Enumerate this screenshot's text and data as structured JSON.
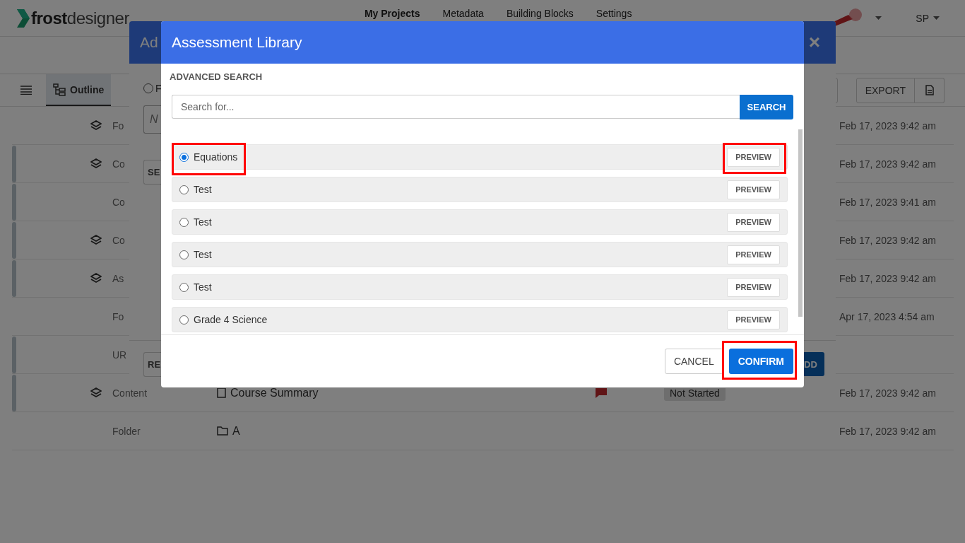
{
  "header": {
    "logo": {
      "bold": "frost",
      "light": "designer"
    },
    "nav": [
      {
        "label": "My Projects",
        "selected": true
      },
      {
        "label": "Metadata",
        "selected": false
      },
      {
        "label": "Building Blocks",
        "selected": false
      },
      {
        "label": "Settings",
        "selected": false
      }
    ],
    "user": "SP"
  },
  "toolbar": {
    "tab": {
      "label": "Outline",
      "selected": true
    },
    "export": "EXPORT"
  },
  "rows": [
    {
      "type": "Fo",
      "marked": false,
      "layers": true,
      "date": "Feb 17, 2023 9:42 am"
    },
    {
      "type": "Co",
      "marked": true,
      "layers": true,
      "date": "Feb 17, 2023 9:42 am"
    },
    {
      "type": "Co",
      "marked": true,
      "layers": false,
      "date": "Feb 17, 2023 9:41 am"
    },
    {
      "type": "Co",
      "marked": true,
      "layers": true,
      "date": "Feb 17, 2023 9:42 am"
    },
    {
      "type": "As",
      "marked": true,
      "layers": true,
      "date": "Feb 17, 2023 9:42 am"
    },
    {
      "type": "Fo",
      "marked": false,
      "layers": false,
      "date": "Apr 17, 2023 4:54 am"
    },
    {
      "type": "UR",
      "marked": true,
      "layers": false
    },
    {
      "type": "Content",
      "marked": true,
      "layers": true,
      "name": {
        "text": "Course Summary",
        "kind": "doc"
      },
      "comment": true,
      "status": "Not Started",
      "date": "Feb 17, 2023 9:42 am"
    },
    {
      "type": "Folder",
      "marked": false,
      "layers": false,
      "name": {
        "text": "A",
        "kind": "folder"
      },
      "date": "Feb 17, 2023 9:42 am"
    }
  ],
  "back_dialog": {
    "title": "Ad",
    "close": "×",
    "radio_checked": false,
    "radio_label": "F",
    "field_placeholder": "N",
    "search_button": "SE",
    "reset_button": "RE",
    "add_button": "DD"
  },
  "dialog": {
    "title": "Assessment Library",
    "section": "ADVANCED SEARCH",
    "search": {
      "placeholder": "Search for...",
      "button": "SEARCH"
    },
    "items": [
      {
        "label": "Equations",
        "selected": true,
        "highlighted": true,
        "preview": "PREVIEW"
      },
      {
        "label": "Test",
        "selected": false,
        "highlighted": false,
        "preview": "PREVIEW"
      },
      {
        "label": "Test",
        "selected": false,
        "highlighted": false,
        "preview": "PREVIEW"
      },
      {
        "label": "Test",
        "selected": false,
        "highlighted": false,
        "preview": "PREVIEW"
      },
      {
        "label": "Test",
        "selected": false,
        "highlighted": false,
        "preview": "PREVIEW"
      },
      {
        "label": "Grade 4 Science",
        "selected": false,
        "highlighted": false,
        "preview": "PREVIEW"
      }
    ],
    "cancel": "CANCEL",
    "confirm": {
      "label": "CONFIRM",
      "highlighted": true
    }
  }
}
